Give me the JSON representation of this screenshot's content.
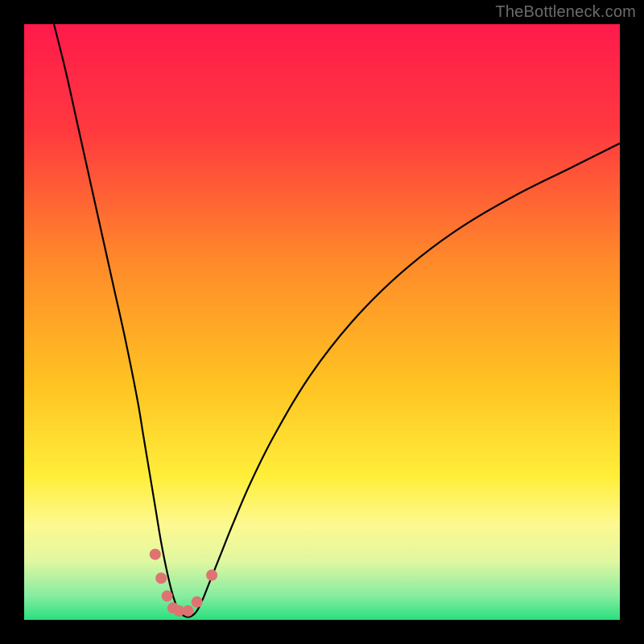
{
  "watermark": "TheBottleneck.com",
  "chart_data": {
    "type": "line",
    "title": "",
    "xlabel": "",
    "ylabel": "",
    "xlim": [
      0,
      100
    ],
    "ylim": [
      0,
      100
    ],
    "background": {
      "type": "vertical-gradient",
      "stops": [
        {
          "pct": 0,
          "color": "#ff1a4b"
        },
        {
          "pct": 18,
          "color": "#ff3a3f"
        },
        {
          "pct": 40,
          "color": "#ff8a2a"
        },
        {
          "pct": 60,
          "color": "#ffc222"
        },
        {
          "pct": 76,
          "color": "#ffee3a"
        },
        {
          "pct": 84,
          "color": "#fdf990"
        },
        {
          "pct": 90,
          "color": "#e2f7a0"
        },
        {
          "pct": 96,
          "color": "#86eda0"
        },
        {
          "pct": 100,
          "color": "#29df7e"
        }
      ]
    },
    "series": [
      {
        "name": "bottleneck-curve",
        "x": [
          5,
          7,
          9,
          11,
          13,
          15,
          17,
          19,
          20,
          21,
          22,
          23,
          24,
          25,
          26,
          27,
          28,
          29,
          30,
          31,
          33,
          35,
          38,
          42,
          48,
          55,
          63,
          72,
          82,
          92,
          100
        ],
        "y": [
          100,
          92,
          83,
          74,
          65,
          56,
          47,
          37,
          31,
          25,
          19,
          13,
          8,
          4,
          1.5,
          0.6,
          0.6,
          1.5,
          3.5,
          6,
          11,
          16,
          23,
          31,
          41,
          50,
          58,
          65,
          71,
          76,
          80
        ]
      }
    ],
    "markers": {
      "name": "valley-dots",
      "color": "#de7373",
      "points": [
        {
          "x": 22.0,
          "y": 11.0
        },
        {
          "x": 23.0,
          "y": 7.0
        },
        {
          "x": 24.0,
          "y": 4.0
        },
        {
          "x": 25.0,
          "y": 2.0
        },
        {
          "x": 26.0,
          "y": 1.5
        },
        {
          "x": 27.5,
          "y": 1.5
        },
        {
          "x": 29.0,
          "y": 3.0
        },
        {
          "x": 31.5,
          "y": 7.5
        }
      ]
    }
  }
}
